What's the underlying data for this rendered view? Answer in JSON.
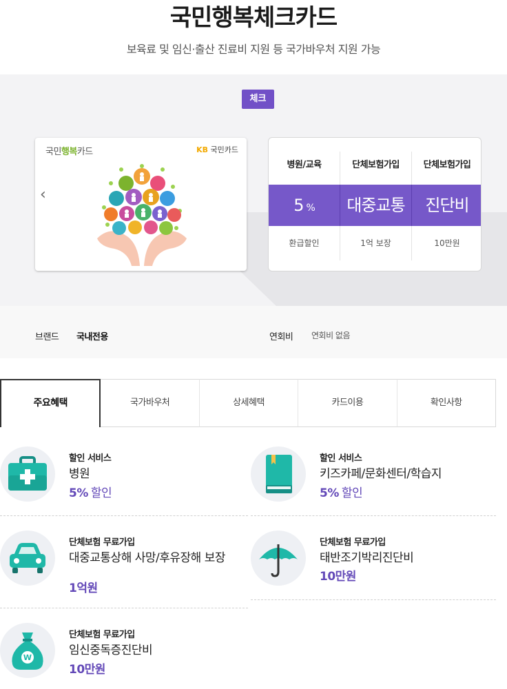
{
  "header": {
    "title": "국민행복체크카드",
    "subtitle": "보육료 및 임신·출산 진료비 지원 등 국가바우처 지원 가능"
  },
  "card": {
    "type_badge": "체크",
    "left_label_prefix": "국민",
    "left_label_highlight": "행복",
    "left_label_suffix": "카드",
    "right_label_kb": "KB",
    "right_label_rest": "국민카드",
    "prev_arrow": "‹"
  },
  "benefits": [
    {
      "head": "병원/교육",
      "value": "5",
      "unit": "%",
      "foot": "환급할인"
    },
    {
      "head": "단체보험가입",
      "value": "대중교통",
      "unit": "",
      "foot": "1억 보장"
    },
    {
      "head": "단체보험가입",
      "value": "진단비",
      "unit": "",
      "foot": "10만원"
    }
  ],
  "info": {
    "brand_label": "브랜드",
    "brand_value": "국내전용",
    "fee_label": "연회비",
    "fee_value": "연회비 없음"
  },
  "tabs": [
    "주요혜택",
    "국가바우처",
    "상세혜택",
    "카드이용",
    "확인사항"
  ],
  "items": [
    {
      "icon": "first-aid-kit-icon",
      "label": "할인 서비스",
      "desc": "병원",
      "amount": "5%",
      "amount_suffix": "할인"
    },
    {
      "icon": "book-icon",
      "label": "할인 서비스",
      "desc": "키즈카페/문화센터/학습지",
      "amount": "5%",
      "amount_suffix": "할인"
    },
    {
      "icon": "car-icon",
      "label": "단체보험 무료가입",
      "desc": "대중교통상해 사망/후유장해 보장",
      "amount": "1억원",
      "amount_suffix": ""
    },
    {
      "icon": "umbrella-icon",
      "label": "단체보험 무료가입",
      "desc": "태반조기박리진단비",
      "amount": "10만원",
      "amount_suffix": ""
    },
    {
      "icon": "money-bag-icon",
      "label": "단체보험 무료가입",
      "desc": "임신중독증진단비",
      "amount": "10만원",
      "amount_suffix": ""
    }
  ],
  "colors": {
    "accent": "#7150c7",
    "teal": "#1fb8a8",
    "hero_bg": "#f3f3f5"
  }
}
